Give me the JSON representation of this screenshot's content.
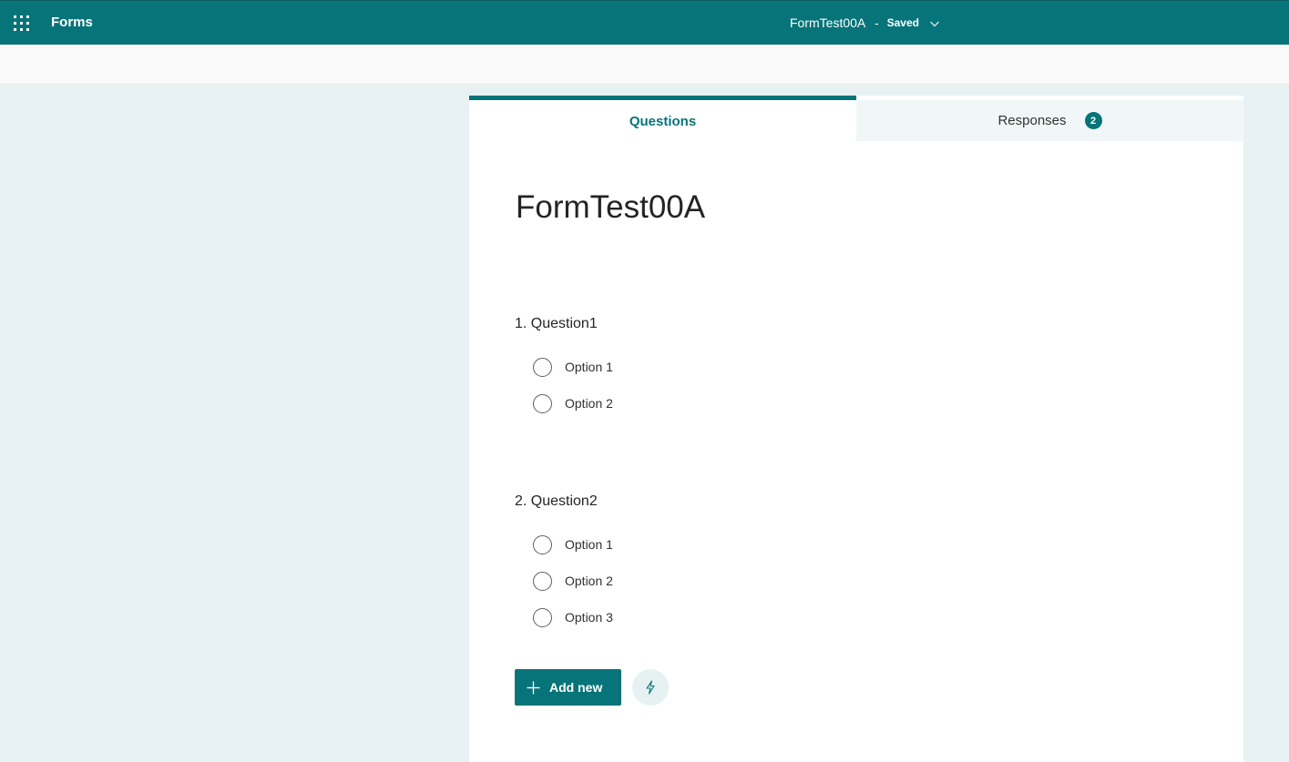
{
  "suite_bar": {
    "app_name": "Forms",
    "doc_title": "FormTest00A",
    "separator": "-",
    "status": "Saved",
    "background": "#077479"
  },
  "tabs": [
    {
      "label": "Questions",
      "active": true
    },
    {
      "label": "Responses",
      "badge": "2",
      "active": false
    }
  ],
  "form": {
    "title": "FormTest00A",
    "questions": [
      {
        "title": "1. Question1",
        "options": [
          "Option 1",
          "Option 2"
        ]
      },
      {
        "title": "2. Question2",
        "options": [
          "Option 1",
          "Option 2",
          "Option 3"
        ]
      }
    ]
  },
  "actions": {
    "add_new_label": "Add new",
    "quick_icon": "lightning-bolt-icon"
  },
  "colors": {
    "accent": "#077479",
    "page_background": "#e8f1f3"
  }
}
